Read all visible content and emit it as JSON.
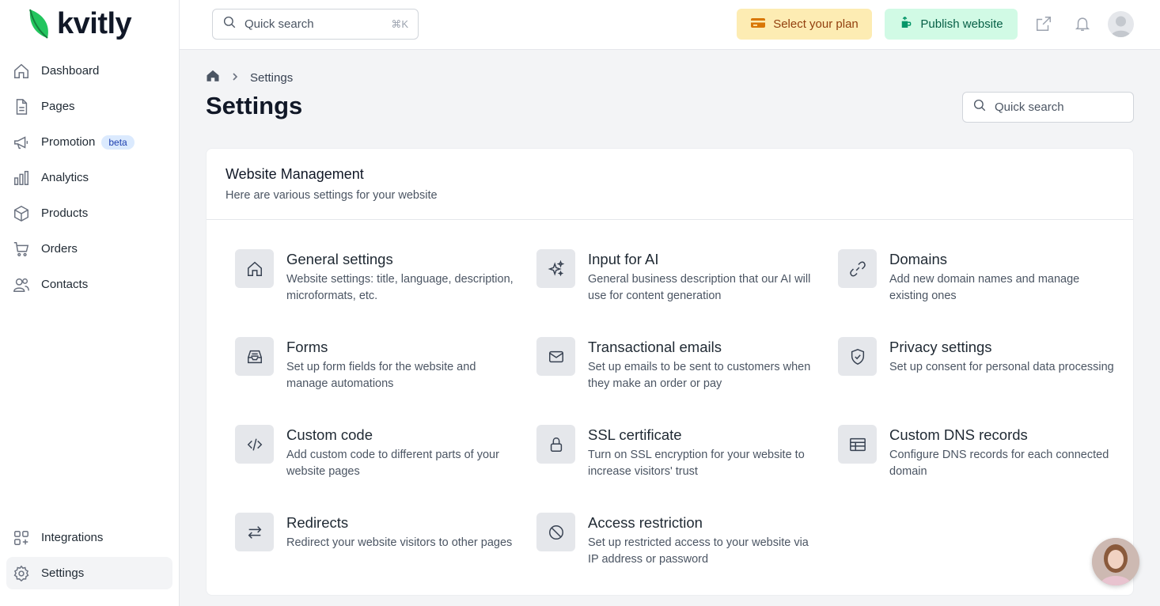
{
  "brand": {
    "name": "kvitly",
    "accent": "#22c55e"
  },
  "sidebar": {
    "items": [
      {
        "label": "Dashboard",
        "icon": "home-icon"
      },
      {
        "label": "Pages",
        "icon": "file-icon"
      },
      {
        "label": "Promotion",
        "icon": "megaphone-icon",
        "badge": "beta"
      },
      {
        "label": "Analytics",
        "icon": "bar-chart-icon"
      },
      {
        "label": "Products",
        "icon": "box-icon"
      },
      {
        "label": "Orders",
        "icon": "cart-icon"
      },
      {
        "label": "Contacts",
        "icon": "users-icon"
      }
    ],
    "bottom_items": [
      {
        "label": "Integrations",
        "icon": "grid-plus-icon"
      },
      {
        "label": "Settings",
        "icon": "gear-icon",
        "active": true
      }
    ]
  },
  "topbar": {
    "search": {
      "placeholder": "Quick search",
      "shortcut": "⌘K"
    },
    "plan_button": "Select your plan",
    "publish_button": "Publish website",
    "plan_color": "#fdecb3",
    "publish_color": "#d1fae5"
  },
  "main": {
    "breadcrumb": {
      "home_icon": "home-icon",
      "current": "Settings"
    },
    "title": "Settings",
    "search_placeholder": "Quick search",
    "section": {
      "title": "Website Management",
      "subtitle": "Here are various settings for your website",
      "tiles": [
        {
          "title": "General settings",
          "desc": "Website settings: title, language, description, microformats, etc.",
          "icon": "house-icon"
        },
        {
          "title": "Input for AI",
          "desc": "General business description that our AI will use for content generation",
          "icon": "sparkles-icon"
        },
        {
          "title": "Domains",
          "desc": "Add new domain names and manage existing ones",
          "icon": "link-icon"
        },
        {
          "title": "Forms",
          "desc": "Set up form fields for the website and manage automations",
          "icon": "inbox-icon"
        },
        {
          "title": "Transactional emails",
          "desc": "Set up emails to be sent to customers when they make an order or pay",
          "icon": "mail-icon"
        },
        {
          "title": "Privacy settings",
          "desc": "Set up consent for personal data processing",
          "icon": "shield-check-icon"
        },
        {
          "title": "Custom code",
          "desc": "Add custom code to different parts of your website pages",
          "icon": "code-icon"
        },
        {
          "title": "SSL certificate",
          "desc": "Turn on SSL encryption for your website to increase visitors' trust",
          "icon": "lock-icon"
        },
        {
          "title": "Custom DNS records",
          "desc": "Configure DNS records for each connected domain",
          "icon": "table-icon"
        },
        {
          "title": "Redirects",
          "desc": "Redirect your website visitors to other pages",
          "icon": "arrows-swap-icon"
        },
        {
          "title": "Access restriction",
          "desc": "Set up restricted access to your website via IP address or password",
          "icon": "ban-icon"
        }
      ]
    }
  }
}
